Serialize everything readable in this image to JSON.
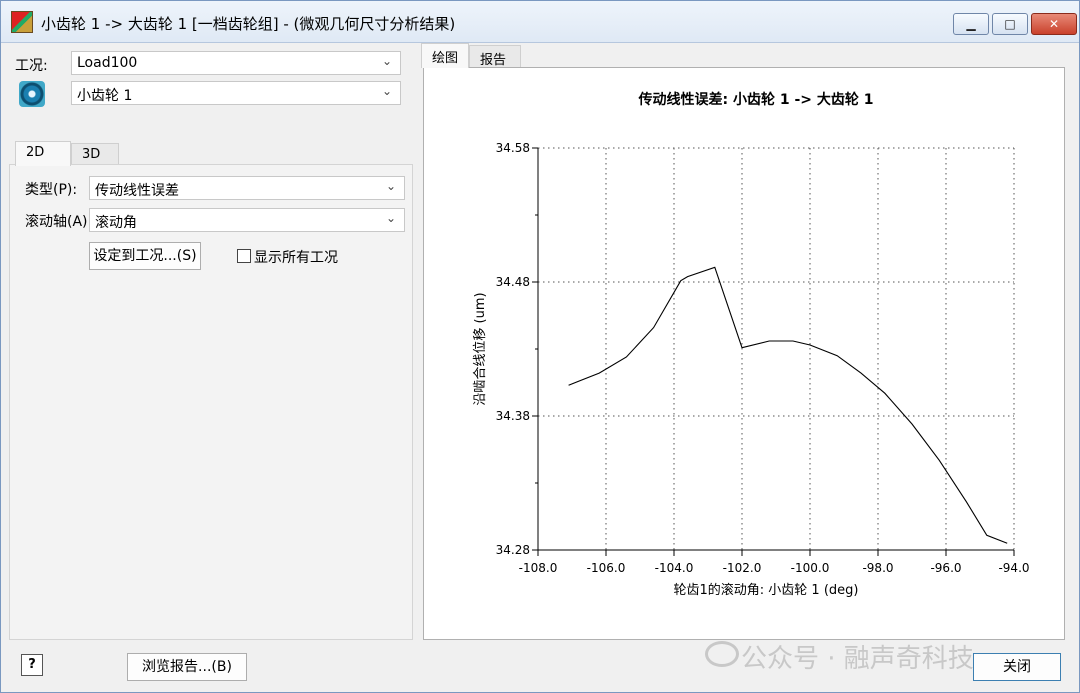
{
  "window": {
    "title": "小齿轮 1 -> 大齿轮 1 [一档齿轮组] - (微观几何尺寸分析结果)",
    "minimize_glyph": "▁",
    "maximize_glyph": "□",
    "close_glyph": "✕"
  },
  "left": {
    "load_label": "工况:",
    "load_value": "Load100",
    "gear_value": "小齿轮 1",
    "tabs": [
      "2D",
      "3D"
    ],
    "type_label": "类型(P):",
    "type_value": "传动线性误差",
    "axis_label": "滚动轴(A)",
    "axis_value": "滚动角",
    "set_to_load_button": "设定到工况...(S)",
    "show_all_loads_label": "显示所有工况",
    "show_all_loads_checked": false
  },
  "right": {
    "tabs": [
      "绘图",
      "报告"
    ]
  },
  "bottom": {
    "help_glyph": "?",
    "browse_report_button": "浏览报告...(B)",
    "close_button": "关闭"
  },
  "watermark": {
    "text": "公众号 · 融声奇科技"
  },
  "chart_data": {
    "type": "line",
    "title": "传动线性误差: 小齿轮 1 -> 大齿轮 1",
    "xlabel": "轮齿1的滚动角: 小齿轮 1 (deg)",
    "ylabel": "沿啮合线位移 (um)",
    "xlim": [
      -108.0,
      -94.0
    ],
    "ylim": [
      34.28,
      34.58
    ],
    "x_ticks": [
      "-108.0",
      "-106.0",
      "-104.0",
      "-102.0",
      "-100.0",
      "-98.0",
      "-96.0",
      "-94.0"
    ],
    "y_ticks": [
      "34.58",
      "34.48",
      "34.38",
      "34.28"
    ],
    "grid": "dotted",
    "series": [
      {
        "x": [
          -107.1,
          -106.2,
          -105.4,
          -104.6,
          -103.8,
          -103.6,
          -102.8,
          -102.0,
          -101.2,
          -100.5,
          -100.0,
          -99.2,
          -98.5,
          -97.8,
          -97.0,
          -96.2,
          -95.4,
          -94.8,
          -94.2
        ],
        "y": [
          34.403,
          34.412,
          34.424,
          34.446,
          34.481,
          34.484,
          34.491,
          34.431,
          34.436,
          34.436,
          34.433,
          34.425,
          34.412,
          34.397,
          34.374,
          34.347,
          34.316,
          34.291,
          34.285
        ]
      }
    ]
  }
}
